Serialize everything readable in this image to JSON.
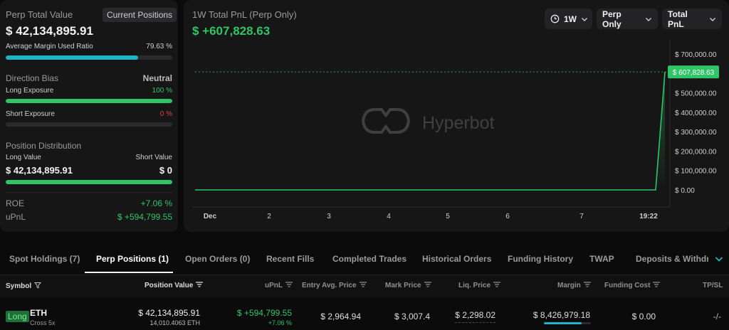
{
  "left": {
    "perp_total_label": "Perp Total Value",
    "current_positions_btn": "Current Positions",
    "perp_total_value": "$ 42,134,895.91",
    "avg_margin_label": "Average Margin Used Ratio",
    "avg_margin_value": "79.63 %",
    "avg_margin_fraction": 0.7963,
    "direction_bias_label": "Direction Bias",
    "direction_bias_value": "Neutral",
    "long_exposure_label": "Long Exposure",
    "long_exposure_value": "100 %",
    "long_exposure_fraction": 1.0,
    "short_exposure_label": "Short Exposure",
    "short_exposure_value": "0 %",
    "short_exposure_fraction": 0.0,
    "position_distribution_label": "Position Distribution",
    "long_value_label": "Long Value",
    "short_value_label": "Short Value",
    "long_value": "$ 42,134,895.91",
    "short_value": "$ 0",
    "roe_label": "ROE",
    "roe_value": "+7.06 %",
    "upnl_label": "uPnL",
    "upnl_value": "$ +594,799.55"
  },
  "chart_panel": {
    "title": "1W Total PnL (Perp Only)",
    "value": "$ +607,828.63",
    "controls": {
      "period": "1W",
      "scope": "Perp Only",
      "metric": "Total PnL"
    },
    "watermark": "Hyperbot",
    "current_label": "$ 607,828.63"
  },
  "chart_data": {
    "type": "line",
    "title": "1W Total PnL (Perp Only)",
    "x_ticks": [
      "Dec",
      "2",
      "3",
      "4",
      "5",
      "6",
      "7",
      "19:22"
    ],
    "y_ticks": [
      "$ 0.00",
      "$ 100,000.00",
      "$ 200,000.00",
      "$ 300,000.00",
      "$ 400,000.00",
      "$ 500,000.00",
      "$ 600,000.00",
      "$ 700,000.00"
    ],
    "ylim": [
      0,
      700000
    ],
    "series": [
      {
        "x": [
          "Dec 1",
          "Dec 2",
          "Dec 3",
          "Dec 4",
          "Dec 5",
          "Dec 6",
          "Dec 7",
          "Dec 8 12:00",
          "Dec 8 19:22"
        ],
        "values": [
          0,
          0,
          0,
          0,
          0,
          0,
          0,
          0,
          607828.63
        ]
      }
    ],
    "reference_line": 607828.63,
    "color": "#2fc466"
  },
  "tabs": [
    {
      "label": "Spot Holdings (7)"
    },
    {
      "label": "Perp Positions (1)"
    },
    {
      "label": "Open Orders (0)"
    },
    {
      "label": "Recent Fills"
    },
    {
      "label": "Completed Trades"
    },
    {
      "label": "Historical Orders"
    },
    {
      "label": "Funding History"
    },
    {
      "label": "TWAP"
    },
    {
      "label": "Deposits & Withdraw"
    }
  ],
  "table": {
    "headers": {
      "symbol": "Symbol",
      "position_value": "Position Value",
      "upnl": "uPnL",
      "entry": "Entry Avg. Price",
      "mark": "Mark Price",
      "liq": "Liq. Price",
      "margin": "Margin",
      "funding": "Funding Cost",
      "tpsl": "TP/SL"
    },
    "row": {
      "side": "Long",
      "symbol": "ETH",
      "leverage": "Cross 5x",
      "position_value": "$ 42,134,895.91",
      "position_size": "14,010.4063 ETH",
      "upnl": "$ +594,799.55",
      "upnl_pct": "+7.06 %",
      "entry": "$ 2,964.94",
      "mark": "$ 3,007.4",
      "liq": "$ 2,298.02",
      "margin": "$ 8,426,979.18",
      "margin_fraction": 0.7963,
      "funding": "$ 0.00",
      "tpsl": "-/-"
    }
  },
  "colors": {
    "green": "#2fc466",
    "red": "#e0433b",
    "teal": "#1fb3c4",
    "bg": "#0b0b0c",
    "panel": "#161617"
  }
}
